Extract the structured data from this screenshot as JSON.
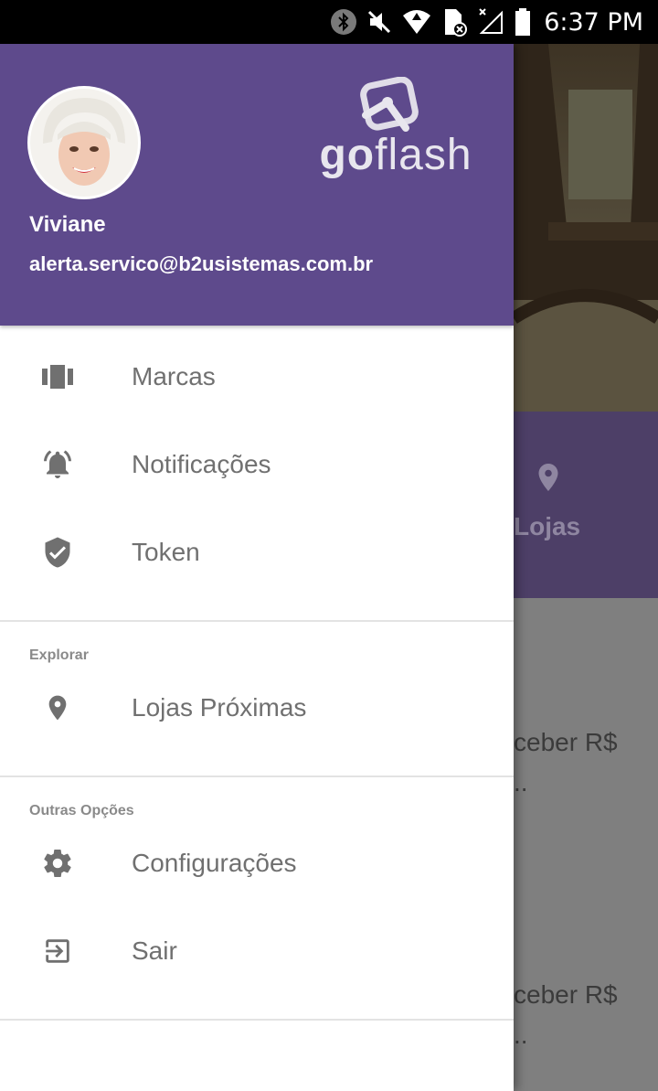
{
  "status_bar": {
    "time": "6:37 PM",
    "icons": [
      "bluetooth-icon",
      "mute-icon",
      "wifi-icon",
      "sim-error-icon",
      "signal-icon",
      "battery-icon"
    ]
  },
  "colors": {
    "header": "#5e4a8c",
    "icon": "#707070",
    "label": "#707070",
    "section_title": "#8a8a8a"
  },
  "drawer": {
    "header": {
      "user_name": "Viviane",
      "user_email": "alerta.servico@b2usistemas.com.br",
      "logo": {
        "text_go": "go",
        "text_flash": "flash"
      }
    },
    "main_items": [
      {
        "label": "Marcas",
        "icon": "cards-icon"
      },
      {
        "label": "Notificações",
        "icon": "bell-icon"
      },
      {
        "label": "Token",
        "icon": "shield-check-icon"
      }
    ],
    "sections": [
      {
        "title": "Explorar",
        "items": [
          {
            "label": "Lojas Próximas",
            "icon": "location-pin-icon"
          }
        ]
      },
      {
        "title": "Outras Opções",
        "items": [
          {
            "label": "Configurações",
            "icon": "gear-icon"
          },
          {
            "label": "Sair",
            "icon": "exit-icon"
          }
        ]
      }
    ]
  },
  "background_app": {
    "lojas_label": "Lojas",
    "text_1a": "ceber R$",
    "text_1b": "..",
    "text_2a": "ceber R$",
    "text_2b": ".."
  }
}
